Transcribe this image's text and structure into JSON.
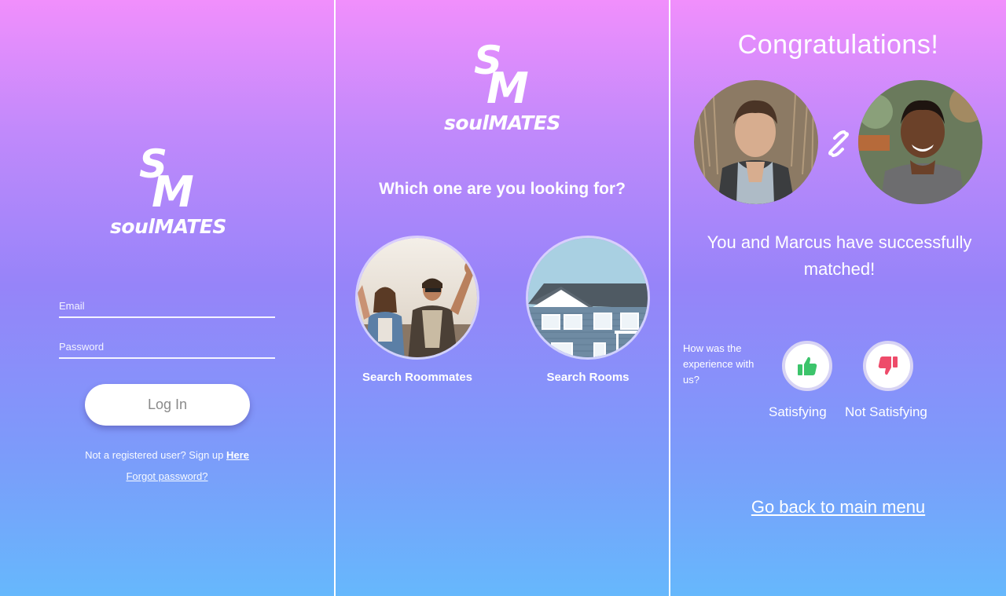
{
  "login_screen": {
    "logo": {
      "mark_s": "S",
      "mark_m": "M",
      "brand": "soulMATES"
    },
    "email_placeholder": "Email",
    "password_placeholder": "Password",
    "login_label": "Log In",
    "signup_prefix": "Not a registered user? Sign up",
    "signup_link": "Here",
    "forgot_link": "Forgot password?"
  },
  "choice_screen": {
    "logo": {
      "mark_s": "S",
      "mark_m": "M",
      "brand": "soulMATES"
    },
    "question": "Which one are you looking for?",
    "options": [
      {
        "label": "Search Roommates",
        "icon": "roommates-photo"
      },
      {
        "label": "Search Rooms",
        "icon": "house-photo"
      }
    ]
  },
  "match_screen": {
    "title": "Congratulations!",
    "match_message": "You and Marcus have successfully matched!",
    "experience_question": "How was the experience with us?",
    "positive_label": "Satisfying",
    "negative_label": "Not Satisfying",
    "back_link": "Go back to main menu",
    "colors": {
      "thumbs_up": "#3cc46b",
      "thumbs_down": "#ee4b6a"
    }
  }
}
